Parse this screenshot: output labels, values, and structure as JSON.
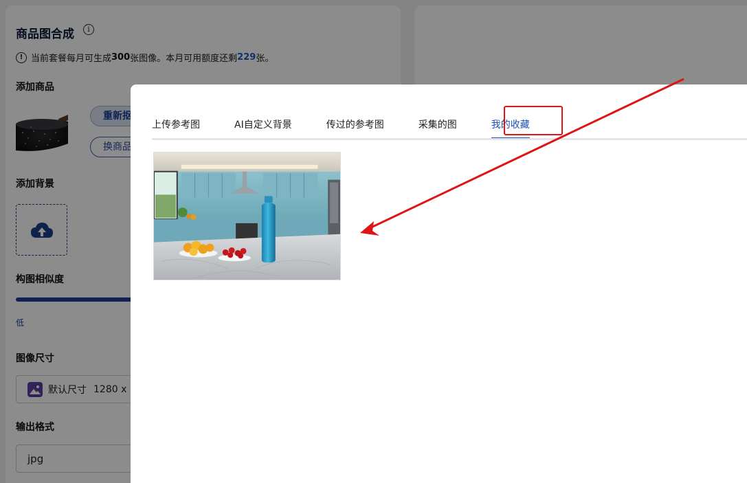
{
  "app": {
    "title": "商品图合成",
    "quota": {
      "prefix": "当前套餐每月可生成",
      "monthly_count": "300",
      "middle": "张图像。本月可用额度还剩",
      "remaining": "229",
      "suffix": "张。"
    },
    "sections": {
      "add_product": "添加商品",
      "add_background": "添加背景",
      "composition_similarity": "构图相似度",
      "image_size": "图像尺寸",
      "output_format": "输出格式"
    },
    "buttons": {
      "rebuild": "重新抠",
      "swap_product": "换商品"
    },
    "similarity": {
      "low_label": "低"
    },
    "size_select": {
      "label": "默认尺寸",
      "dims": "1280 x"
    },
    "format_select": {
      "value": "jpg"
    }
  },
  "modal": {
    "tabs": [
      {
        "label": "上传参考图",
        "active": false
      },
      {
        "label": "AI自定义背景",
        "active": false
      },
      {
        "label": "传过的参考图",
        "active": false
      },
      {
        "label": "采集的图",
        "active": false
      },
      {
        "label": "我的收藏",
        "active": true
      }
    ]
  },
  "colors": {
    "accent": "#1d4fb8",
    "annotation": "#e01414"
  }
}
